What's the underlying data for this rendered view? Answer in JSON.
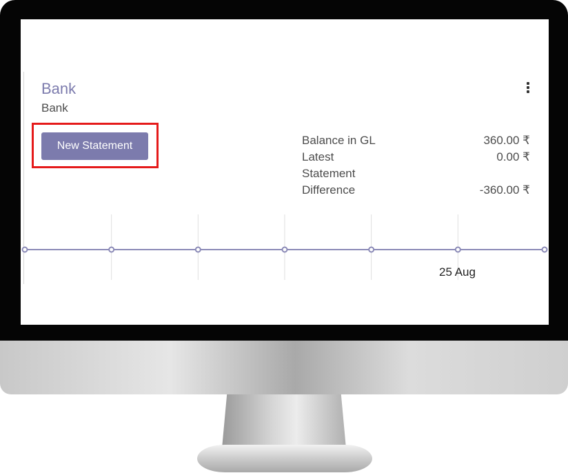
{
  "journal": {
    "title": "Bank",
    "type": "Bank"
  },
  "actions": {
    "new_statement_label": "New Statement"
  },
  "summary": {
    "balance_gl_label": "Balance in GL",
    "balance_gl_value": "360.00 ₹",
    "latest_label": "Latest Statement",
    "latest_value": "0.00 ₹",
    "difference_label": "Difference",
    "difference_value": "-360.00 ₹"
  },
  "chart_data": {
    "type": "line",
    "x": [
      "",
      "",
      "",
      "",
      "",
      "25 Aug",
      ""
    ],
    "values": [
      0,
      0,
      0,
      0,
      0,
      0,
      0
    ],
    "title": "",
    "xlabel": "",
    "ylabel": "",
    "grid": true,
    "color": "#8a89b6"
  },
  "colors": {
    "accent": "#7c7bad",
    "highlight": "#e51a1a"
  }
}
